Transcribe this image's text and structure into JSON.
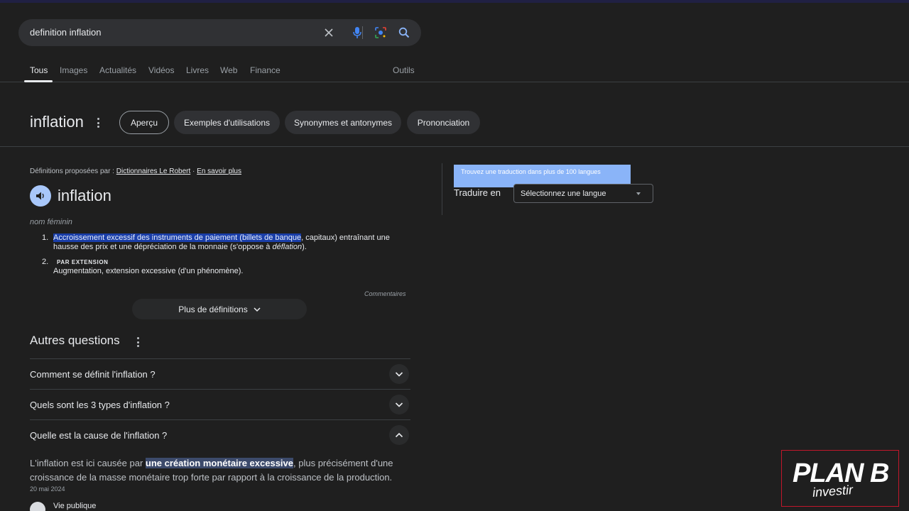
{
  "search": {
    "query": "definition inflation"
  },
  "nav_tabs": [
    {
      "label": "Tous",
      "active": true
    },
    {
      "label": "Images"
    },
    {
      "label": "Actualités"
    },
    {
      "label": "Vidéos"
    },
    {
      "label": "Livres"
    },
    {
      "label": "Web"
    },
    {
      "label": "Finance"
    }
  ],
  "tools_label": "Outils",
  "word_header": {
    "word": "inflation",
    "chips": [
      "Aperçu",
      "Exemples d'utilisations",
      "Synonymes et antonymes",
      "Prononciation"
    ]
  },
  "dictionary": {
    "source_prefix": "Définitions proposées par :",
    "source_name": "Dictionnaires Le Robert",
    "separator": "·",
    "learn_more": "En savoir plus",
    "word": "inflation",
    "part_of_speech": "nom féminin",
    "definitions": [
      {
        "num": "1.",
        "highlighted": "Accroissement excessif des instruments de paiement (billets de banque",
        "rest1": ", capitaux) entraînant une hausse des prix et une dépréciation de la monnaie (s'oppose à ",
        "italic": "déflation",
        "rest2": ")."
      },
      {
        "num": "2.",
        "tag": "PAR EXTENSION",
        "text": "Augmentation, extension excessive (d'un phénomène)."
      }
    ],
    "comments": "Commentaires",
    "more_button": "Plus de définitions"
  },
  "other_questions": {
    "title": "Autres questions",
    "items": [
      {
        "q": "Comment se définit l'inflation ?"
      },
      {
        "q": "Quels sont les 3 types d'inflation ?"
      },
      {
        "q": "Quelle est la cause de l'inflation ?"
      }
    ],
    "answer": {
      "before": "L'inflation est ici causée par ",
      "highlight": "une création monétaire excessive",
      "after": ", plus précisément d'une croissance de la masse monétaire trop forte par rapport à la croissance de la production.",
      "date": "20 mai 2024",
      "source": "Vie publique"
    }
  },
  "translate": {
    "tooltip": "Trouvez une traduction dans plus de 100 langues",
    "label": "Traduire en",
    "select_value": "Sélectionnez une langue"
  },
  "watermark": {
    "text": "PLAN B",
    "sub": "investir"
  },
  "colors": {
    "background": "#1f1f1f",
    "surface": "#303134",
    "selection_highlight": "#1a3ea8",
    "tooltip": "#8ab4f8",
    "brand_red": "#c0172b"
  }
}
